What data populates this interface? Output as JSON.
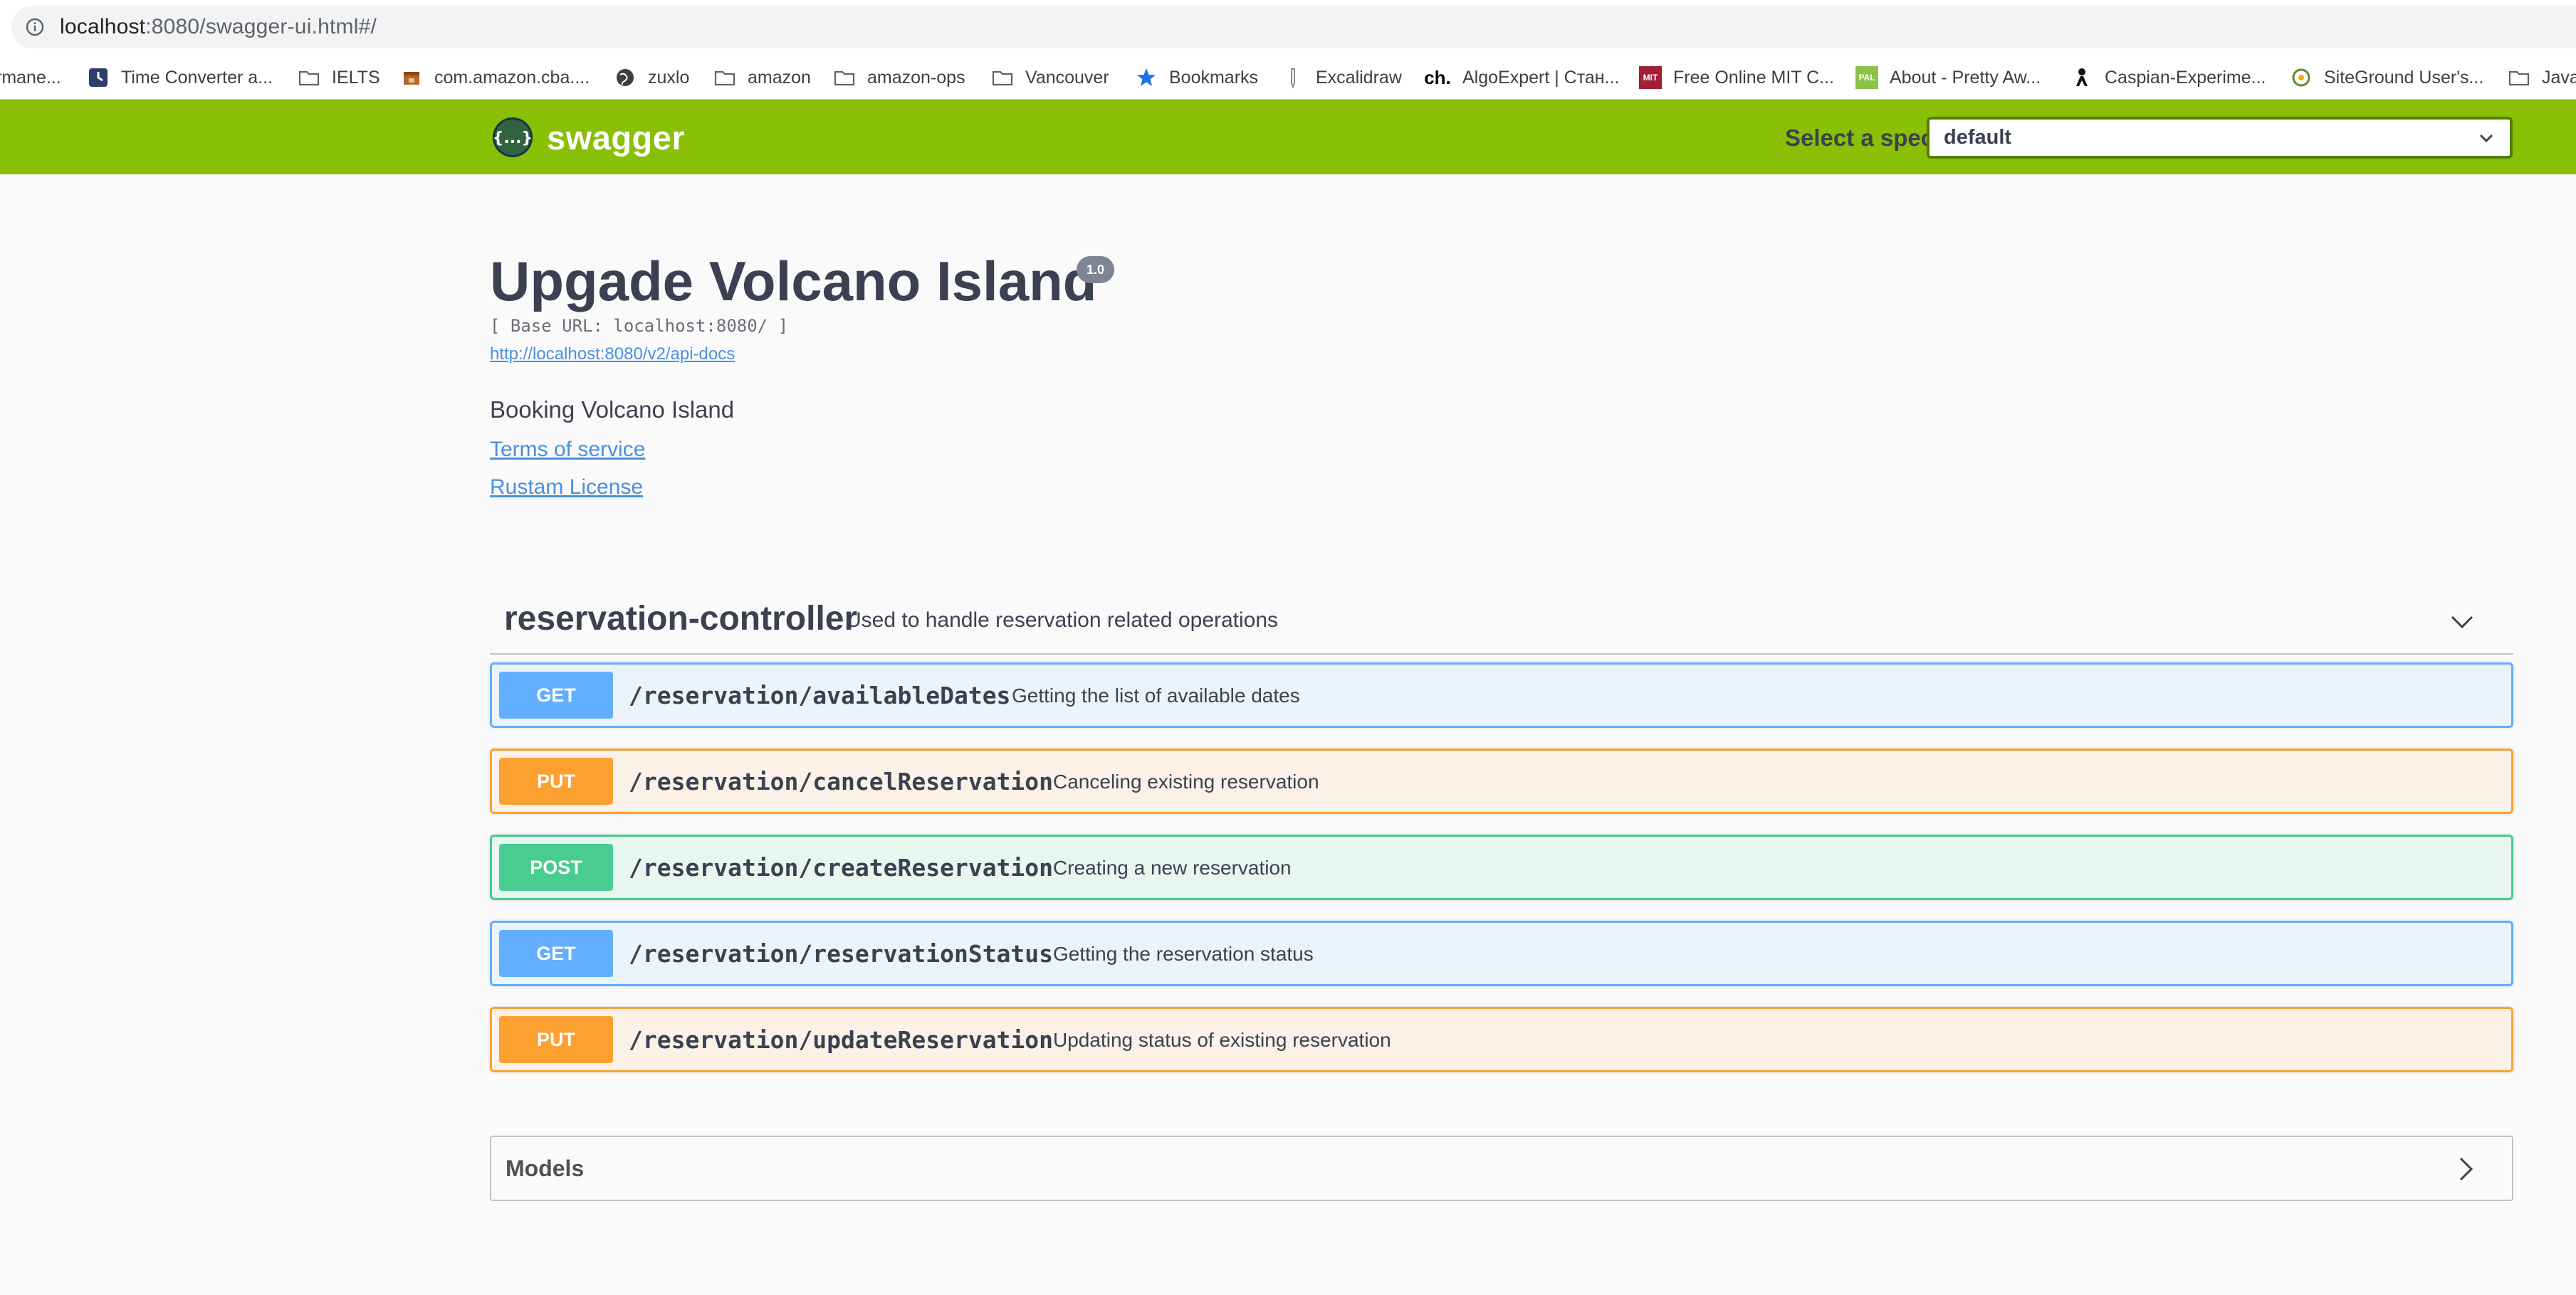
{
  "browser": {
    "url_host": "localhost",
    "url_rest": ":8080/swagger-ui.html#/",
    "bookmarks": [
      {
        "label": "rmane...",
        "icon": "none"
      },
      {
        "label": "Time Converter a...",
        "icon": "clock-icon"
      },
      {
        "label": "IELTS",
        "icon": "folder-icon"
      },
      {
        "label": "com.amazon.cba....",
        "icon": "box-icon"
      },
      {
        "label": "zuxlo",
        "icon": "globe-icon"
      },
      {
        "label": "amazon",
        "icon": "folder-icon"
      },
      {
        "label": "amazon-ops",
        "icon": "folder-icon"
      },
      {
        "label": "Vancouver",
        "icon": "folder-icon"
      },
      {
        "label": "Bookmarks",
        "icon": "star-icon"
      },
      {
        "label": "Excalidraw",
        "icon": "pencil-icon"
      },
      {
        "label": "AlgoExpert | Стан...",
        "icon": "ch-logo-icon"
      },
      {
        "label": "Free Online MIT C...",
        "icon": "mit-icon"
      },
      {
        "label": "About - Pretty Aw...",
        "icon": "pal-icon"
      },
      {
        "label": "Caspian-Experime...",
        "icon": "person-icon"
      },
      {
        "label": "SiteGround User's...",
        "icon": "siteground-icon"
      },
      {
        "label": "Java",
        "icon": "folder-icon"
      }
    ],
    "bm_icon_labels": {
      "ch": "ch.",
      "mit": "MIT",
      "pal": "PAL"
    }
  },
  "topbar": {
    "logo_text": "swagger",
    "logo_glyph": "{...}",
    "spec_label": "Select a spec",
    "spec_value": "default",
    "brand_color": "#89bf04"
  },
  "info": {
    "title": "Upgade Volcano Island",
    "version": "1.0",
    "base_url": "[ Base URL: localhost:8080/ ]",
    "api_docs_url": "http://localhost:8080/v2/api-docs",
    "description": "Booking Volcano Island",
    "terms_label": "Terms of service",
    "license_label": "Rustam License"
  },
  "controller": {
    "name": "reservation-controller",
    "description": "Used to handle reservation related operations",
    "expanded": true
  },
  "operations": [
    {
      "method": "GET",
      "path": "/reservation/availableDates",
      "summary": "Getting the list of available dates"
    },
    {
      "method": "PUT",
      "path": "/reservation/cancelReservation",
      "summary": "Canceling existing reservation"
    },
    {
      "method": "POST",
      "path": "/reservation/createReservation",
      "summary": "Creating a new reservation"
    },
    {
      "method": "GET",
      "path": "/reservation/reservationStatus",
      "summary": "Getting the reservation status"
    },
    {
      "method": "PUT",
      "path": "/reservation/updateReservation",
      "summary": "Updating status of existing reservation"
    }
  ],
  "method_colors": {
    "GET": "#61affe",
    "PUT": "#fca130",
    "POST": "#49cc90"
  },
  "models": {
    "title": "Models",
    "expanded": false
  }
}
